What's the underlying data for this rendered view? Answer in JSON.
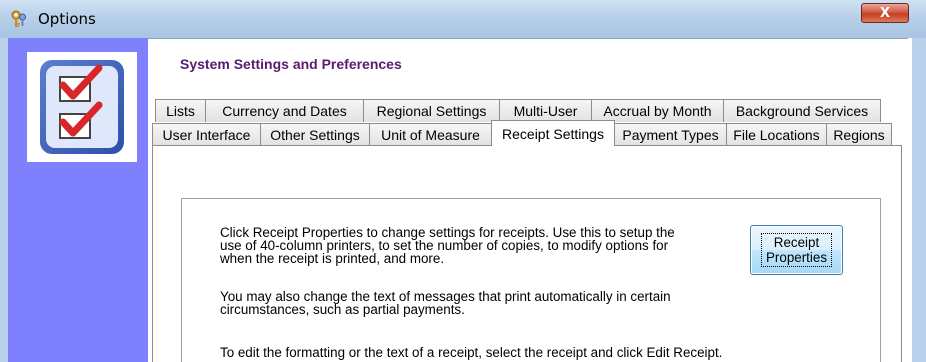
{
  "window": {
    "title": "Options",
    "close_label": "X"
  },
  "header": {
    "title": "System Settings and Preferences"
  },
  "tabs": {
    "row1": [
      "Lists",
      "Currency and Dates",
      "Regional Settings",
      "Multi-User",
      "Accrual by Month",
      "Background Services"
    ],
    "row2": [
      "User Interface",
      "Other Settings",
      "Unit of Measure",
      "Receipt Settings",
      "Payment Types",
      "File Locations",
      "Regions"
    ],
    "selected": "Receipt Settings"
  },
  "content": {
    "para1": [
      "Click Receipt Properties to change settings for receipts. Use this to setup the",
      "use of 40-column printers, to set the number of copies, to modify options for",
      "when the receipt is printed, and more."
    ],
    "para2": [
      "You may also change the text of messages that print automatically in certain",
      "circumstances, such as partial payments."
    ],
    "para3": "To edit the formatting or the text of a receipt, select the receipt and click Edit Receipt.",
    "button": {
      "line1": "Receipt",
      "line2": "Properties"
    }
  },
  "colors": {
    "sidebar": "#7f80fe",
    "header_title": "#5b1a6f",
    "check_red": "#d9262b"
  },
  "icons": {
    "title": "keys-icon",
    "logo": "checklist-icon"
  }
}
